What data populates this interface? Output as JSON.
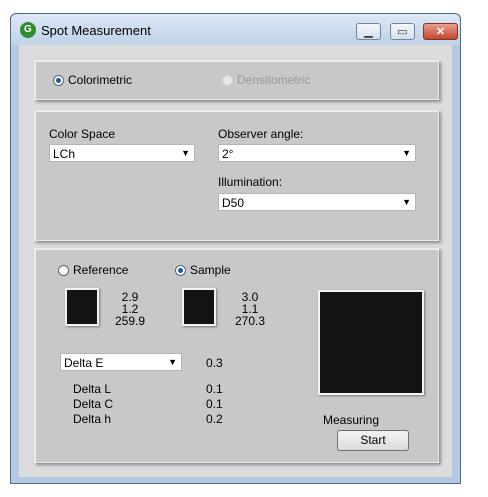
{
  "window": {
    "title": "Spot Measurement",
    "app_icon_glyph": "G"
  },
  "mode": {
    "colorimetric_label": "Colorimetric",
    "densitometric_label": "Densitometric"
  },
  "settings": {
    "color_space_label": "Color Space",
    "color_space_value": "LCh",
    "observer_label": "Observer angle:",
    "observer_value": "2°",
    "illumination_label": "Illumination:",
    "illumination_value": "D50"
  },
  "measure": {
    "reference_label": "Reference",
    "sample_label": "Sample",
    "reference_values": [
      "2.9",
      "1.2",
      "259.9"
    ],
    "sample_values": [
      "3.0",
      "1.1",
      "270.3"
    ],
    "delta_select_value": "Delta E",
    "delta_e_value": "0.3",
    "deltas": [
      {
        "label": "Delta L",
        "value": "0.1"
      },
      {
        "label": "Delta C",
        "value": "0.1"
      },
      {
        "label": "Delta h",
        "value": "0.2"
      }
    ],
    "status_label": "Measuring",
    "start_label": "Start"
  },
  "colors": {
    "swatch": "#141414",
    "radio_selected": "#1c5a9c"
  }
}
